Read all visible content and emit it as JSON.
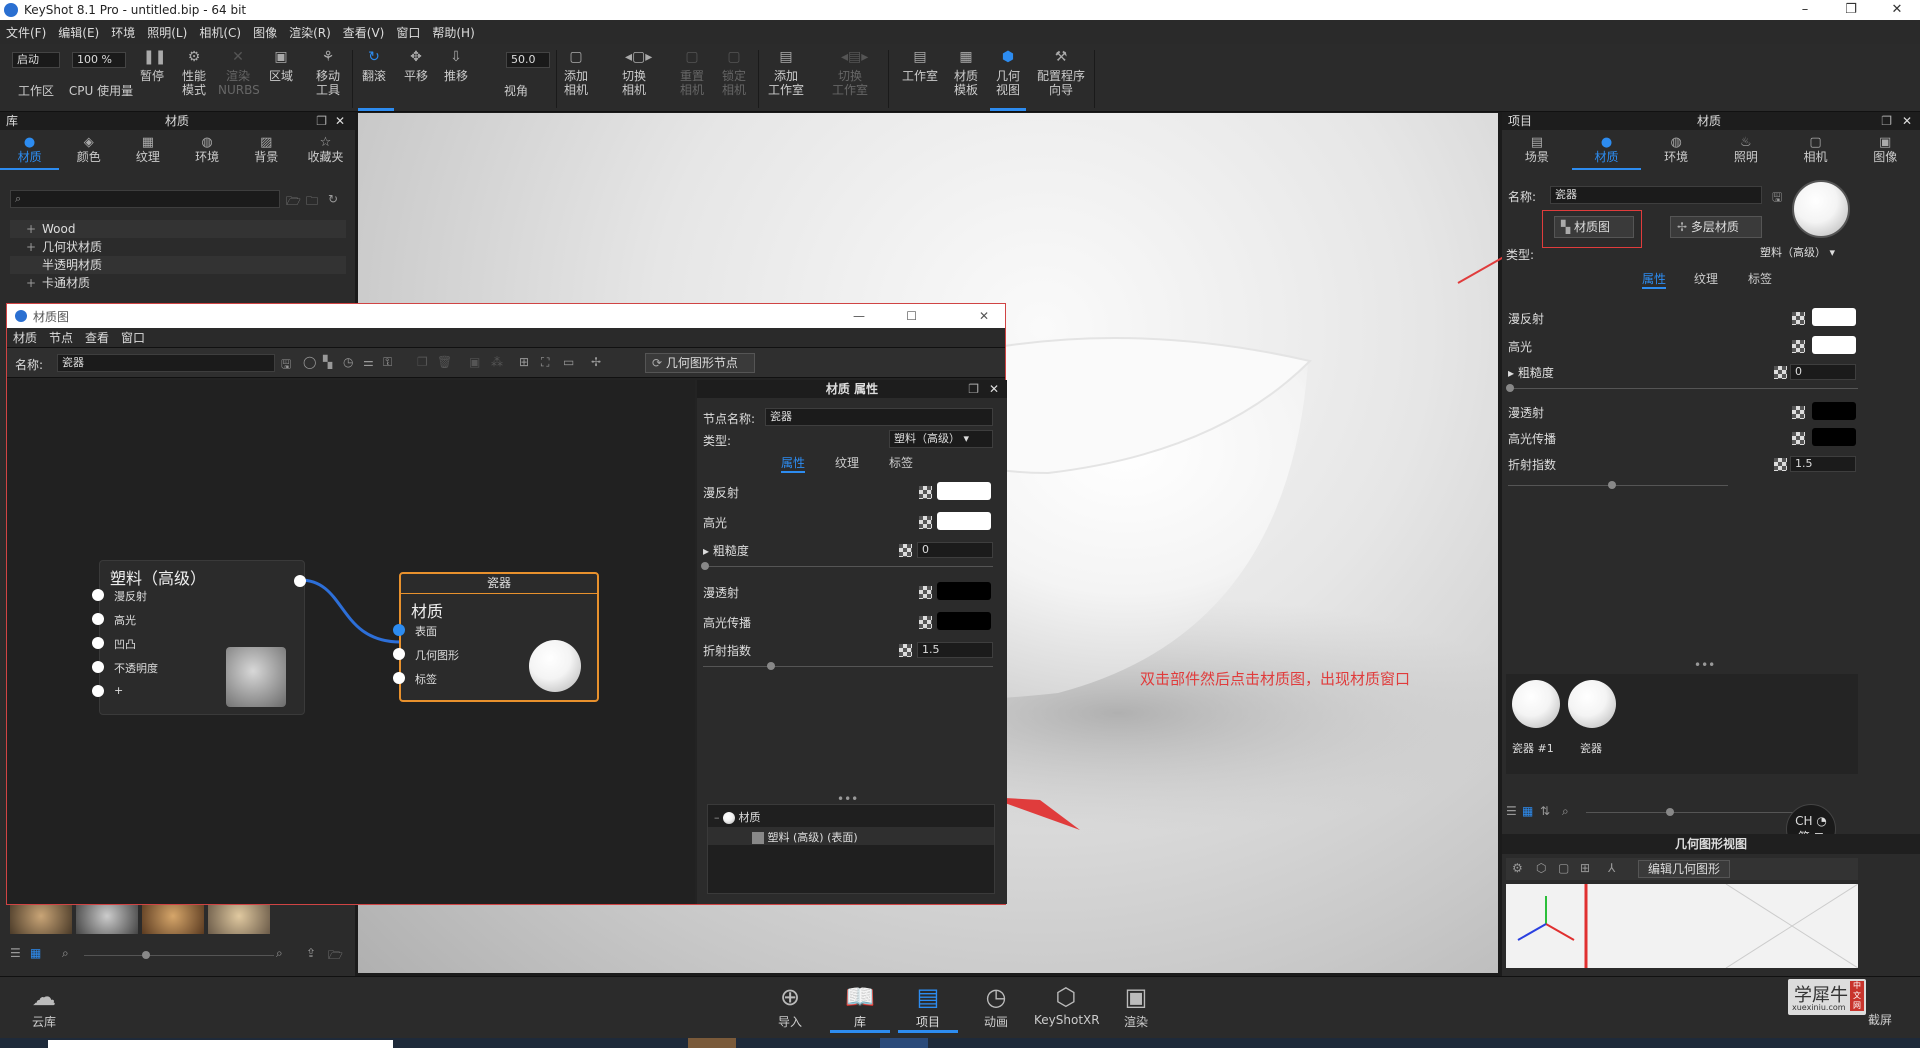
{
  "app": {
    "title": "KeyShot 8.1 Pro  - untitled.bip  - 64 bit",
    "window_controls": [
      "–",
      "❐",
      "✕"
    ]
  },
  "menu": [
    "文件(F)",
    "编辑(E)",
    "环境",
    "照明(L)",
    "相机(C)",
    "图像",
    "渲染(R)",
    "查看(V)",
    "窗口",
    "帮助(H)"
  ],
  "toolbar": {
    "mode_value": "启动",
    "percent_value": "100 %",
    "fov_value": "50.0",
    "items": [
      {
        "label": "工作区",
        "icon": "workspace-icon"
      },
      {
        "label": "CPU 使用量",
        "icon": "cpu-icon"
      },
      {
        "label": "暂停",
        "icon": "pause-icon"
      },
      {
        "label": "性能\n模式",
        "icon": "performance-icon"
      },
      {
        "label": "渲染\nNURBS",
        "icon": "nurbs-icon"
      },
      {
        "label": "区域",
        "icon": "region-icon"
      },
      {
        "label": "移动\n工具",
        "icon": "move-tool-icon"
      },
      {
        "label": "翻滚",
        "icon": "tumble-icon"
      },
      {
        "label": "平移",
        "icon": "pan-icon"
      },
      {
        "label": "推移",
        "icon": "dolly-icon"
      },
      {
        "label": "视角",
        "icon": "perspective-icon"
      },
      {
        "label": "添加\n相机",
        "icon": "add-camera-icon"
      },
      {
        "label": "切换\n相机",
        "icon": "switch-camera-icon"
      },
      {
        "label": "重置\n相机",
        "icon": "reset-camera-icon"
      },
      {
        "label": "锁定\n相机",
        "icon": "lock-camera-icon"
      },
      {
        "label": "添加\n工作室",
        "icon": "add-studio-icon"
      },
      {
        "label": "切换\n工作室",
        "icon": "switch-studio-icon"
      },
      {
        "label": "工作室",
        "icon": "studio-icon"
      },
      {
        "label": "材质\n模板",
        "icon": "material-template-icon"
      },
      {
        "label": "几何\n视图",
        "icon": "geometry-view-icon"
      },
      {
        "label": "配置程序\n向导",
        "icon": "configurator-wizard-icon"
      }
    ]
  },
  "library": {
    "header": "库",
    "title": "材质",
    "tabs": [
      "材质",
      "颜色",
      "纹理",
      "环境",
      "背景",
      "收藏夹"
    ],
    "tree": [
      {
        "label": "Wood",
        "expand": "+"
      },
      {
        "label": "几何状材质",
        "expand": "+"
      },
      {
        "label": "半透明材质",
        "expand": ""
      },
      {
        "label": "卡通材质",
        "expand": "+"
      }
    ]
  },
  "material_window": {
    "title": "材质图",
    "menu": [
      "材质",
      "节点",
      "查看",
      "窗口"
    ],
    "name_label": "名称:",
    "name_value": "瓷器",
    "geometry_node_button": "几何图形节点",
    "node_plastic": {
      "title": "塑料（高级）",
      "inputs": [
        "漫反射",
        "高光",
        "凹凸",
        "不透明度",
        "+"
      ]
    },
    "node_material": {
      "header": "瓷器",
      "title": "材质",
      "inputs": [
        "表面",
        "几何图形",
        "标签"
      ]
    },
    "props": {
      "title": "材质 属性",
      "node_name_label": "节点名称:",
      "node_name_value": "瓷器",
      "type_label": "类型:",
      "type_value": "塑料（高级）",
      "tabs": [
        "属性",
        "纹理",
        "标签"
      ],
      "rows": [
        {
          "label": "漫反射",
          "color": "#ffffff"
        },
        {
          "label": "高光",
          "color": "#ffffff"
        },
        {
          "label": "粗糙度",
          "value": "0"
        },
        {
          "label": "漫透射",
          "color": "#000000"
        },
        {
          "label": "高光传播",
          "color": "#000000"
        },
        {
          "label": "折射指数",
          "value": "1.5"
        }
      ],
      "tree_root": "材质",
      "tree_child": "塑料 (高级) (表面)"
    }
  },
  "annotation": "双击部件然后点击材质图，出现材质窗口",
  "project": {
    "header": "项目",
    "title": "材质",
    "tabs": [
      "场景",
      "材质",
      "环境",
      "照明",
      "相机",
      "图像"
    ],
    "name_label": "名称:",
    "name_value": "瓷器",
    "material_graph_button": "材质图",
    "multilayer_button": "多层材质",
    "type_label": "类型:",
    "type_value": "塑料（高级）",
    "subtabs": [
      "属性",
      "纹理",
      "标签"
    ],
    "rows": [
      {
        "label": "漫反射",
        "color": "#ffffff"
      },
      {
        "label": "高光",
        "color": "#ffffff"
      },
      {
        "label": "粗糙度",
        "value": "0"
      },
      {
        "label": "漫透射",
        "color": "#000000"
      },
      {
        "label": "高光传播",
        "color": "#000000"
      },
      {
        "label": "折射指数",
        "value": "1.5"
      }
    ],
    "thumbs": [
      "瓷器 #1",
      "瓷器"
    ],
    "geometry_view_title": "几何图形视图",
    "edit_geometry_button": "编辑几何图形",
    "ime": {
      "lang": "CH",
      "mode": "简"
    }
  },
  "bottom": {
    "cloud": "云库",
    "items": [
      "导入",
      "库",
      "项目",
      "动画",
      "KeyShotXR",
      "渲染"
    ],
    "screenshot": "截屏",
    "watermark": "学犀牛",
    "watermark_sub": "xuexiniu.com",
    "watermark_tag": "中文网"
  },
  "colors": {
    "accent": "#2d8cf0",
    "annotation": "#e03c3c"
  }
}
